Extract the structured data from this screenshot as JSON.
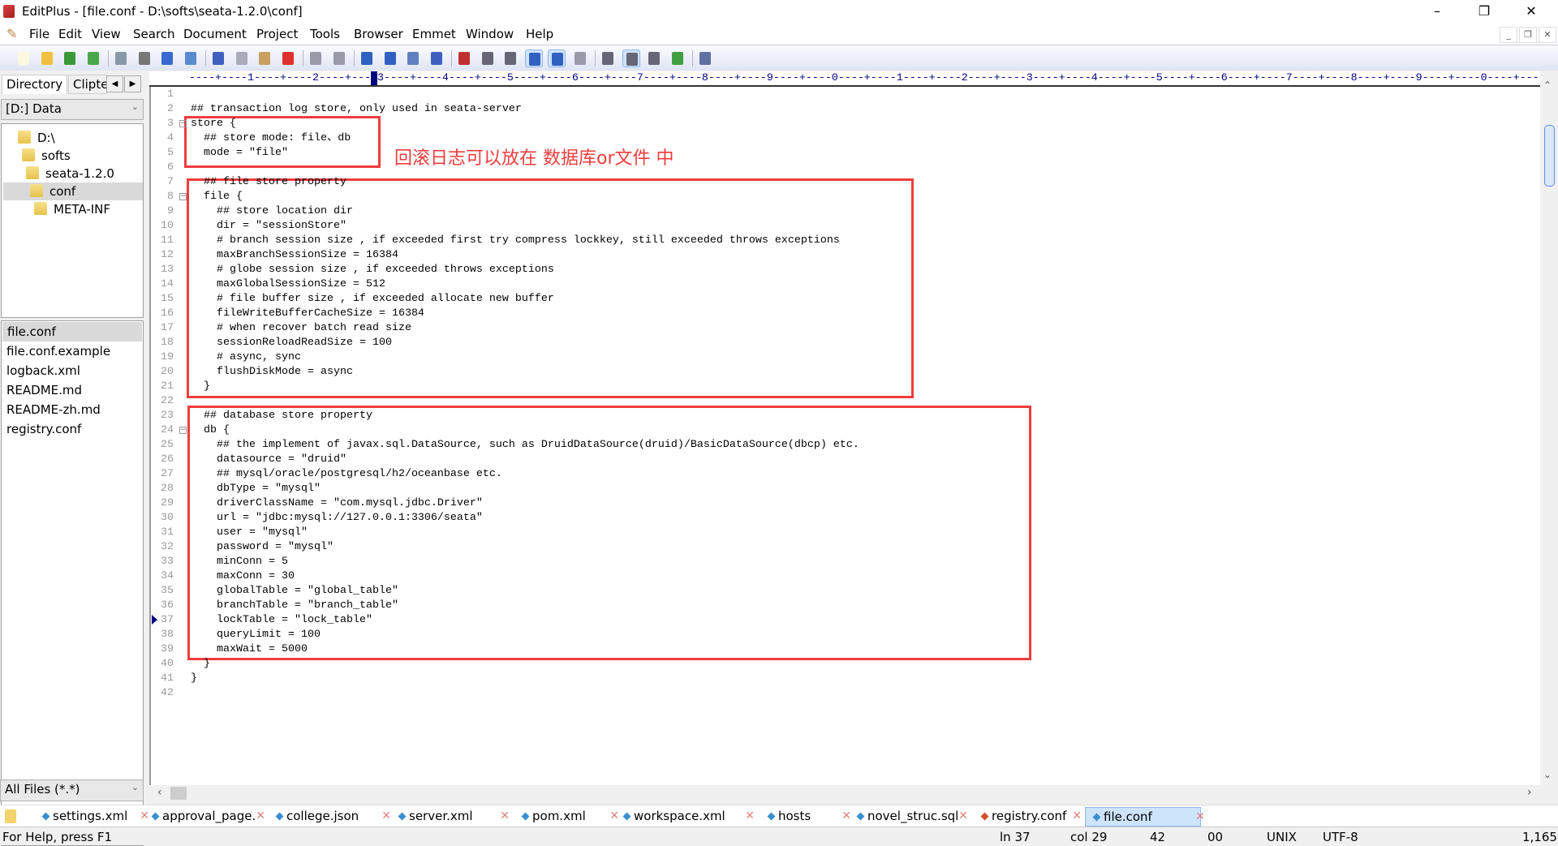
{
  "window": {
    "title": "EditPlus - [file.conf - D:\\softs\\seata-1.2.0\\conf]"
  },
  "menu": [
    "File",
    "Edit",
    "View",
    "Search",
    "Document",
    "Project",
    "Tools",
    "Browser",
    "Emmet",
    "Window",
    "Help"
  ],
  "toolbar_icons": [
    "new-file-icon",
    "open-icon",
    "save-icon",
    "save-all-icon",
    "print-preview-icon",
    "print-icon",
    "spell-check-icon",
    "browser-preview-icon",
    "cut-icon",
    "copy-icon",
    "paste-icon",
    "delete-icon",
    "undo-icon",
    "redo-icon",
    "find-icon",
    "replace-icon",
    "find-in-files-icon",
    "goto-line-icon",
    "font-icon",
    "html-heading-icon",
    "word-wrap-icon",
    "line-number-icon",
    "column-select-icon",
    "settings-icon",
    "directory-window-icon",
    "cliptext-window-icon",
    "output-window-icon",
    "fullscreen-icon",
    "help-icon"
  ],
  "left_panel": {
    "tabs": [
      "Directory",
      "Clipte"
    ],
    "drive": "[D:] Data",
    "tree": [
      "D:\\",
      "softs",
      "seata-1.2.0",
      "conf",
      "META-INF"
    ],
    "selected_folder": "conf",
    "files": [
      "file.conf",
      "file.conf.example",
      "logback.xml",
      "README.md",
      "README-zh.md",
      "registry.conf"
    ],
    "selected_file": "file.conf",
    "filter": "All Files (*.*)"
  },
  "editor": {
    "cursor_line": 37,
    "fold_lines": [
      3,
      8,
      24
    ],
    "lines": [
      "",
      "## transaction log store, only used in seata-server",
      "store {",
      "  ## store mode: file、db",
      "  mode = \"file\"",
      "",
      "  ## file store property",
      "  file {",
      "    ## store location dir",
      "    dir = \"sessionStore\"",
      "    # branch session size , if exceeded first try compress lockkey, still exceeded throws exceptions",
      "    maxBranchSessionSize = 16384",
      "    # globe session size , if exceeded throws exceptions",
      "    maxGlobalSessionSize = 512",
      "    # file buffer size , if exceeded allocate new buffer",
      "    fileWriteBufferCacheSize = 16384",
      "    # when recover batch read size",
      "    sessionReloadReadSize = 100",
      "    # async, sync",
      "    flushDiskMode = async",
      "  }",
      "",
      "  ## database store property",
      "  db {",
      "    ## the implement of javax.sql.DataSource, such as DruidDataSource(druid)/BasicDataSource(dbcp) etc.",
      "    datasource = \"druid\"",
      "    ## mysql/oracle/postgresql/h2/oceanbase etc.",
      "    dbType = \"mysql\"",
      "    driverClassName = \"com.mysql.jdbc.Driver\"",
      "    url = \"jdbc:mysql://127.0.0.1:3306/seata\"",
      "    user = \"mysql\"",
      "    password = \"mysql\"",
      "    minConn = 5",
      "    maxConn = 30",
      "    globalTable = \"global_table\"",
      "    branchTable = \"branch_table\"",
      "    lockTable = \"lock_table\"",
      "    queryLimit = 100",
      "    maxWait = 5000",
      "  }",
      "}",
      ""
    ],
    "annotation": "回滚日志可以放在 数据库or文件 中",
    "annotation_color": "#f03c3c"
  },
  "doc_tabs": [
    "settings.xml",
    "approval_page.",
    "college.json",
    "server.xml",
    "pom.xml",
    "workspace.xml",
    "hosts",
    "novel_struc.sql",
    "registry.conf",
    "file.conf"
  ],
  "active_tab": "file.conf",
  "status": {
    "help": "For Help, press F1",
    "line": "ln 37",
    "col": "col 29",
    "lines": "42",
    "code": "00",
    "eol": "UNIX",
    "encoding": "UTF-8",
    "size": "1,165"
  }
}
